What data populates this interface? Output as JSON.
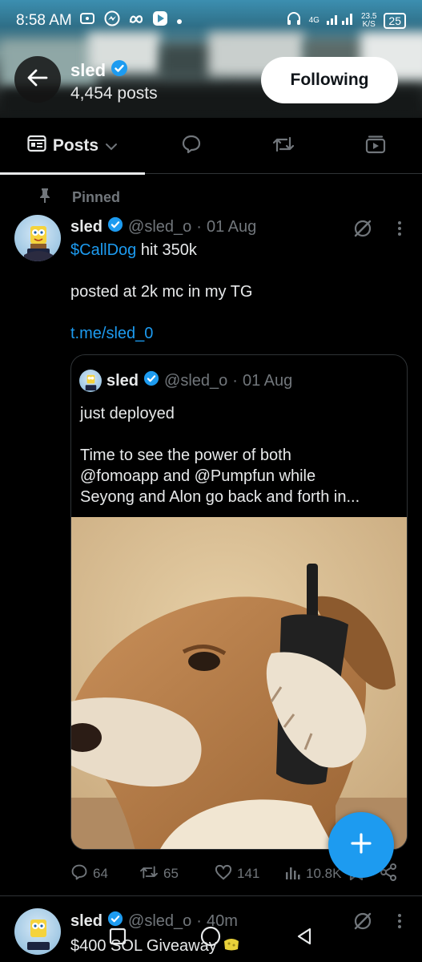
{
  "status_bar": {
    "time": "8:58 AM",
    "network": "4G",
    "speed_value": "23.5",
    "speed_unit": "K/S",
    "battery": "25"
  },
  "header": {
    "name": "sled",
    "posts_count": "4,454 posts",
    "follow_button": "Following"
  },
  "tabs": [
    {
      "label": "Posts",
      "icon": "posts-icon",
      "active": true
    },
    {
      "label": "",
      "icon": "replies-icon"
    },
    {
      "label": "",
      "icon": "retweet-icon"
    },
    {
      "label": "",
      "icon": "media-icon"
    }
  ],
  "pinned_label": "Pinned",
  "tweet": {
    "name": "sled",
    "handle": "@sled_o",
    "separator": "·",
    "date": "01 Aug",
    "cashtag": "$CallDog",
    "line1_rest": " hit 350k",
    "line2": "posted at 2k mc in my TG",
    "link": "t.me/sled_0",
    "quote": {
      "name": "sled",
      "handle": "@sled_o",
      "separator": "·",
      "date": "01 Aug",
      "line1": "just deployed",
      "line2": "Time to see the power of both",
      "line3": "@fomoapp and @Pumpfun while",
      "line4": "Seyong and Alon go back and forth in..."
    },
    "stats": {
      "replies": "64",
      "reposts": "65",
      "likes": "141",
      "views": "10.8K"
    }
  },
  "next_tweet": {
    "name": "sled",
    "handle": "@sled_o",
    "separator": "·",
    "time": "40m",
    "text": "$400 SOL Giveaway"
  },
  "colors": {
    "accent": "#1d9bf0",
    "background": "#000000",
    "muted": "#71767b",
    "verified": "#1d9bf0"
  }
}
